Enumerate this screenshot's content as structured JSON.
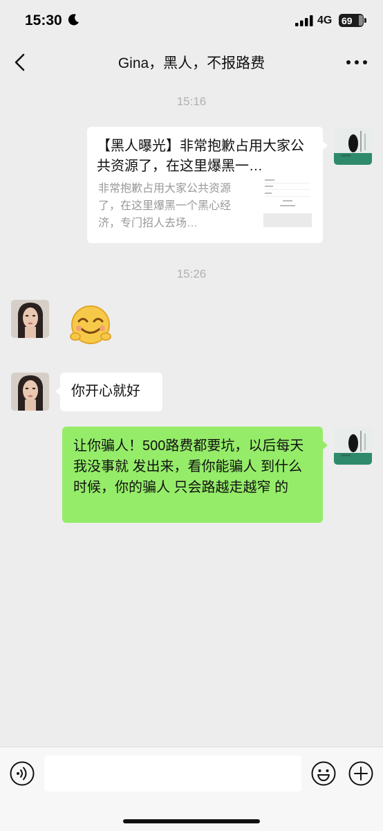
{
  "status": {
    "time": "15:30",
    "network": "4G",
    "battery": "69"
  },
  "header": {
    "title": "Gina，黑人，不报路费"
  },
  "messages": {
    "ts1": "15:16",
    "card": {
      "title": "【黑人曝光】非常抱歉占用大家公共资源了，在这里爆黑一…",
      "desc": "非常抱歉占用大家公共资源了，在这里爆黑一个黑心经济，专门招人去场…"
    },
    "ts2": "15:26",
    "reply": "你开心就好",
    "mine": "让你骗人！500路费都要坑，以后每天 我没事就 发出来，看你能骗人 到什么时候，你的骗人 只会路越走越窄 的"
  },
  "input": {
    "value": ""
  }
}
